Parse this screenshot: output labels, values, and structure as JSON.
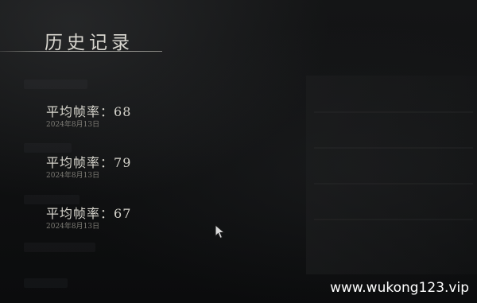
{
  "page": {
    "title": "历史记录"
  },
  "records": [
    {
      "label": "平均帧率：",
      "value": "68",
      "date": "2024年8月13日"
    },
    {
      "label": "平均帧率：",
      "value": "79",
      "date": "2024年8月13日"
    },
    {
      "label": "平均帧率：",
      "value": "67",
      "date": "2024年8月13日"
    }
  ],
  "watermark": "www.wukong123.vip",
  "icons": {
    "cursor": "mouse-pointer-icon"
  }
}
